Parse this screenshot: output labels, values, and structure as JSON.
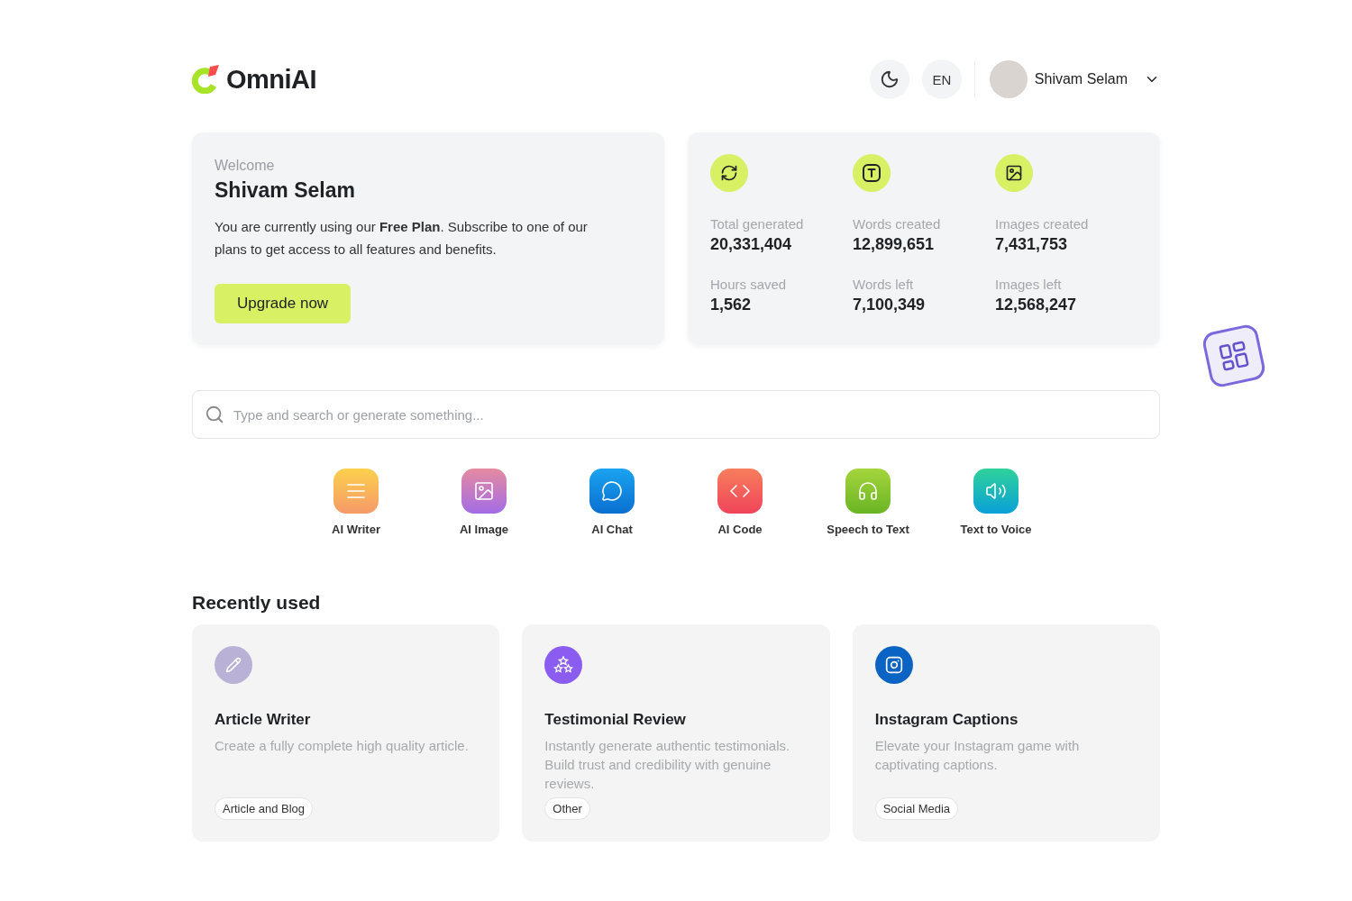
{
  "header": {
    "logo": "OmniAI",
    "language": "EN",
    "user": {
      "name": "Shivam Selam"
    }
  },
  "welcome": {
    "greeting": "Welcome",
    "name": "Shivam Selam",
    "message": "You are currently using our **Free Plan**. Subscribe to one of our plans to get access to all features and benefits.",
    "button": "Upgrade now"
  },
  "stats": {
    "columns": [
      {
        "kind": "refresh",
        "items": [
          {
            "label": "Total generated",
            "value": "20,331,404"
          },
          {
            "label": "Hours saved",
            "value": "1,562"
          }
        ]
      },
      {
        "kind": "text",
        "items": [
          {
            "label": "Words created",
            "value": "12,899,651"
          },
          {
            "label": "Words left",
            "value": "7,100,349"
          }
        ]
      },
      {
        "kind": "image",
        "items": [
          {
            "label": "Images created",
            "value": "7,431,753"
          },
          {
            "label": "Images left",
            "value": "12,568,247"
          }
        ]
      }
    ]
  },
  "search": {
    "placeholder": "Type and search or generate something..."
  },
  "tools": [
    {
      "kind": "writer",
      "label": "AI Writer"
    },
    {
      "kind": "image",
      "label": "AI Image"
    },
    {
      "kind": "chat",
      "label": "AI Chat"
    },
    {
      "kind": "code",
      "label": "AI Code"
    },
    {
      "kind": "speech",
      "label": "Speech to Text"
    },
    {
      "kind": "voice",
      "label": "Text to Voice"
    }
  ],
  "recently_used": {
    "title": "Recently used",
    "cards": [
      {
        "kind": "pencil",
        "color": "#b9b2d6",
        "title": "Article Writer",
        "description": "Create a fully complete high quality article.",
        "tag": "Article and Blog"
      },
      {
        "kind": "stars",
        "color": "#8b5cf0",
        "title": "Testimonial Review",
        "description": "Instantly generate authentic testimonials. Build trust and credibility with genuine reviews.",
        "tag": "Other"
      },
      {
        "kind": "instagram",
        "color": "#0b63c4",
        "title": "Instagram Captions",
        "description": "Elevate your Instagram game with captivating captions.",
        "tag": "Social Media"
      }
    ]
  }
}
